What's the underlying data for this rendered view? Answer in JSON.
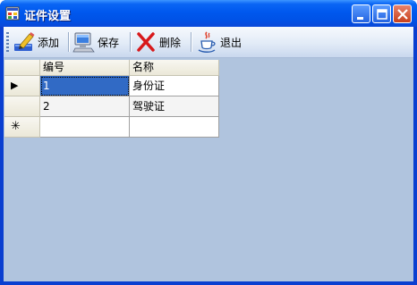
{
  "window": {
    "title": "证件设置"
  },
  "toolbar": {
    "add_label": "添加",
    "save_label": "保存",
    "delete_label": "删除",
    "exit_label": "退出"
  },
  "grid": {
    "columns": [
      "编号",
      "名称"
    ],
    "rows": [
      {
        "id": "1",
        "name": "身份证",
        "current": true
      },
      {
        "id": "2",
        "name": "驾驶证",
        "current": false
      }
    ],
    "current_row_marker": "▶",
    "new_row_marker": "✳"
  },
  "colors": {
    "title_bar": "#0058ee",
    "client_bg": "#b0c4de",
    "selection": "#316ac5"
  }
}
